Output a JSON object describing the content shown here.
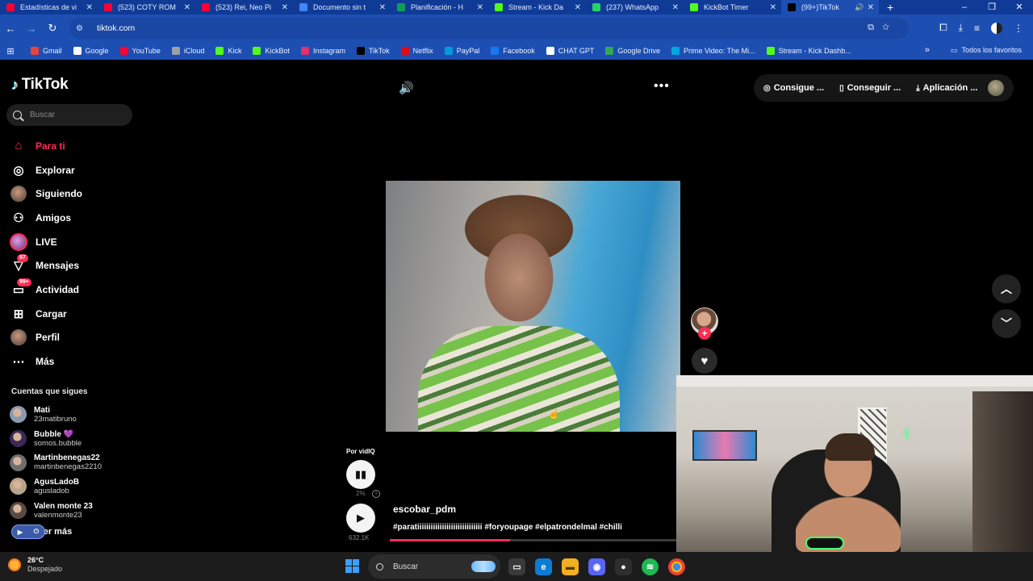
{
  "browser": {
    "tabs": [
      {
        "title": "Estadísticas de vi",
        "color": "#ff0033"
      },
      {
        "title": "(523) COTY ROM",
        "color": "#ff0033"
      },
      {
        "title": "(523) Rei, Neo Pi",
        "color": "#ff0033"
      },
      {
        "title": "Documento sin t",
        "color": "#4285f4"
      },
      {
        "title": "Planificación - H",
        "color": "#0f9d58"
      },
      {
        "title": "Stream - Kick Da",
        "color": "#53fc18"
      },
      {
        "title": "(237) WhatsApp",
        "color": "#25d366"
      },
      {
        "title": "KickBot Timer",
        "color": "#53fc18"
      },
      {
        "title": "(99+)TikTok",
        "color": "#000000"
      }
    ],
    "url": "tiktok.com",
    "bookmarks": [
      {
        "label": "Gmail",
        "color": "#ea4335"
      },
      {
        "label": "Google",
        "color": "#ffffff"
      },
      {
        "label": "YouTube",
        "color": "#ff0033"
      },
      {
        "label": "iCloud",
        "color": "#9aa0a6"
      },
      {
        "label": "Kick",
        "color": "#53fc18"
      },
      {
        "label": "KickBot",
        "color": "#53fc18"
      },
      {
        "label": "Instagram",
        "color": "#e1306c"
      },
      {
        "label": "TikTok",
        "color": "#000000"
      },
      {
        "label": "Netflix",
        "color": "#e50914"
      },
      {
        "label": "PayPal",
        "color": "#009cde"
      },
      {
        "label": "Facebook",
        "color": "#1877f2"
      },
      {
        "label": "CHAT GPT",
        "color": "#ffffff"
      },
      {
        "label": "Google Drive",
        "color": "#34a853"
      },
      {
        "label": "Prime Video: The Mi...",
        "color": "#00a8e1"
      },
      {
        "label": "Stream - Kick Dashb...",
        "color": "#53fc18"
      }
    ],
    "all_bookmarks": "Todos los favoritos"
  },
  "tiktok": {
    "logo": "TikTok",
    "search_placeholder": "Buscar",
    "nav": [
      {
        "label": "Para ti",
        "icon": "home-icon"
      },
      {
        "label": "Explorar",
        "icon": "compass-icon"
      },
      {
        "label": "Siguiendo",
        "icon": "following-avatar"
      },
      {
        "label": "Amigos",
        "icon": "friends-icon"
      },
      {
        "label": "LIVE",
        "icon": "live-avatar"
      },
      {
        "label": "Mensajes",
        "icon": "messages-icon",
        "badge": "97"
      },
      {
        "label": "Actividad",
        "icon": "activity-icon",
        "badge": "99+"
      },
      {
        "label": "Cargar",
        "icon": "upload-icon"
      },
      {
        "label": "Perfil",
        "icon": "profile-avatar"
      },
      {
        "label": "Más",
        "icon": "more-icon"
      }
    ],
    "following_title": "Cuentas que sigues",
    "following": [
      {
        "name": "Mati",
        "handle": "23matibruno",
        "color": "#8a9bb0"
      },
      {
        "name": "Bubble 💜",
        "handle": "somos.bubble",
        "color": "#3b2a55"
      },
      {
        "name": "Martinbenegas22",
        "handle": "martinbenegas2210",
        "color": "#6e6e6e"
      },
      {
        "name": "AgusLadoB",
        "handle": "agusladob",
        "color": "#b9a58a"
      },
      {
        "name": "Valen monte 23",
        "handle": "valenmonte23",
        "color": "#5b4a44"
      }
    ],
    "see_more": "Ver más",
    "top_buttons": [
      "Consigue ...",
      "Conseguir ...",
      "Aplicación ..."
    ],
    "video": {
      "author": "escobar_pdm",
      "caption": "#paratiiiiiiiiiiiiiiiiiiiiiiiiiiiii #foryoupage #elpatrondelmal #chilli",
      "progress": 0.42
    },
    "music": {
      "by": "Por vidIQ",
      "percent": "2%",
      "plays": "632.1K"
    }
  },
  "taskbar": {
    "temp": "26°C",
    "weather": "Despejado",
    "search": "Buscar"
  }
}
